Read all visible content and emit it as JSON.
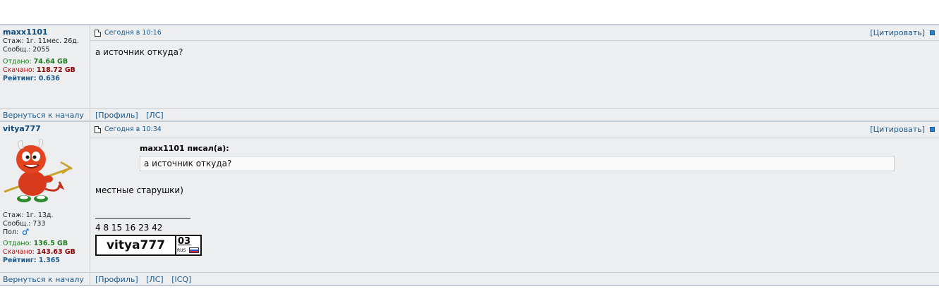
{
  "posts": [
    {
      "nick": "maxx1101",
      "stazh": "Стаж: 1г. 11мес. 26д.",
      "soobsh": "Сообщ.: 2055",
      "otdano_label": "Отдано:",
      "otdano_value": "74.64 GB",
      "skachano_label": "Скачано:",
      "skachano_value": "118.72 GB",
      "rating": "Рейтинг: 0.636",
      "date": "Сегодня в 10:16",
      "quote_link": "[Цитировать]",
      "message": "а источник откуда?",
      "back": "Вернуться к началу",
      "links": [
        "[Профиль]",
        "[ЛС]"
      ]
    },
    {
      "nick": "vitya777",
      "stazh": "Стаж: 1г. 13д.",
      "soobsh": "Сообщ.: 733",
      "pol": "Пол:",
      "otdano_label": "Отдано:",
      "otdano_value": "136.5 GB",
      "skachano_label": "Скачано:",
      "skachano_value": "143.63 GB",
      "rating": "Рейтинг: 1.365",
      "date": "Сегодня в 10:34",
      "quote_link": "[Цитировать]",
      "quote_author": "maxx1101 писал(а):",
      "quote_text": "а источник откуда?",
      "message": "местные старушки)",
      "signature": "4 8 15 16 23 42",
      "plate_name": "vitya777",
      "plate_region": "03",
      "plate_country": "RUS",
      "back": "Вернуться к началу",
      "links": [
        "[Профиль]",
        "[ЛС]",
        "[ICQ]"
      ]
    }
  ],
  "icons": {
    "date": "post-date-icon",
    "quote_marker": "blue-square-icon",
    "gender": "male-icon",
    "avatar": "red-devil-avatar"
  },
  "colors": {
    "link": "#1b5a8a",
    "nick": "#0c4a7a",
    "upload": "#1e7a1e",
    "download": "#b01010",
    "background": "#eceef0"
  }
}
